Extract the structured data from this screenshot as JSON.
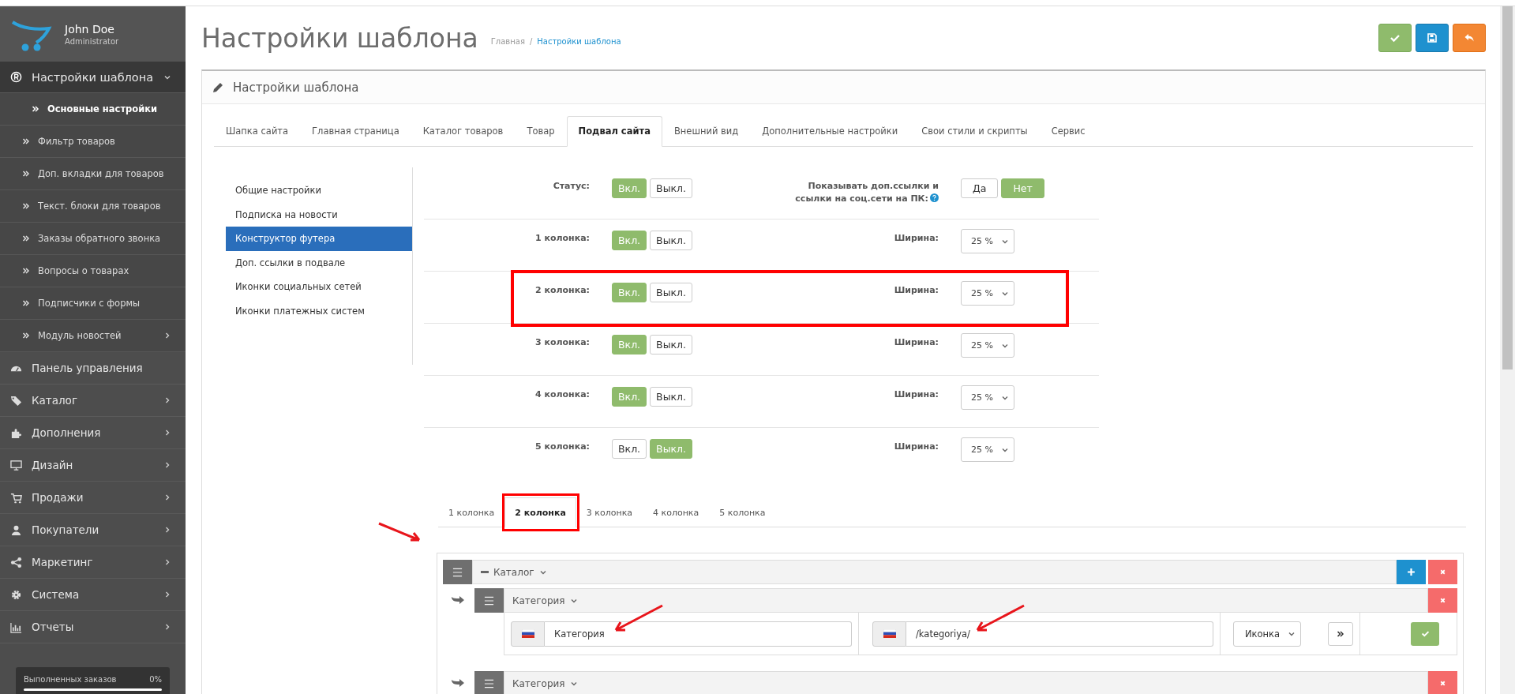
{
  "sidebar": {
    "user": {
      "name": "John Doe",
      "role": "Administrator"
    },
    "menu": [
      {
        "label": "Настройки шаблона",
        "kind": "registered",
        "expandable": true,
        "expanded": true,
        "children": [
          {
            "label": "Основные настройки",
            "selected": true,
            "expandable": false
          },
          {
            "label": "Фильтр товаров",
            "selected": false,
            "expandable": false
          },
          {
            "label": "Доп. вкладки для товаров",
            "selected": false,
            "expandable": false
          },
          {
            "label": "Текст. блоки для товаров",
            "selected": false,
            "expandable": false
          },
          {
            "label": "Заказы обратного звонка",
            "selected": false,
            "expandable": false
          },
          {
            "label": "Вопросы о товарах",
            "selected": false,
            "expandable": false
          },
          {
            "label": "Подписчики с формы",
            "selected": false,
            "expandable": false
          },
          {
            "label": "Модуль новостей",
            "selected": false,
            "expandable": true
          }
        ]
      },
      {
        "label": "Панель управления",
        "kind": "dashboard",
        "expandable": false,
        "expanded": false
      },
      {
        "label": "Каталог",
        "kind": "tag",
        "expandable": true,
        "expanded": false
      },
      {
        "label": "Дополнения",
        "kind": "puzzle",
        "expandable": true,
        "expanded": false
      },
      {
        "label": "Дизайн",
        "kind": "monitor",
        "expandable": true,
        "expanded": false
      },
      {
        "label": "Продажи",
        "kind": "cart",
        "expandable": true,
        "expanded": false
      },
      {
        "label": "Покупатели",
        "kind": "user",
        "expandable": true,
        "expanded": false
      },
      {
        "label": "Маркетинг",
        "kind": "share",
        "expandable": true,
        "expanded": false
      },
      {
        "label": "Система",
        "kind": "gear",
        "expandable": true,
        "expanded": false
      },
      {
        "label": "Отчеты",
        "kind": "chart",
        "expandable": true,
        "expanded": false
      }
    ],
    "progress": {
      "label": "Выполненных заказов",
      "value": "0%",
      "level": 0
    }
  },
  "page": {
    "title": "Настройки шаблона",
    "breadcrumb": [
      {
        "label": "Главная",
        "current": false
      },
      {
        "separator": "/",
        "label": "Настройки шаблона",
        "current": true
      }
    ],
    "actions": [
      {
        "kind": "apply"
      },
      {
        "kind": "save"
      },
      {
        "kind": "back"
      }
    ]
  },
  "panel": {
    "title": "Настройки шаблона",
    "tabs": [
      {
        "label": "Шапка сайта",
        "selected": false
      },
      {
        "label": "Главная страница",
        "selected": false
      },
      {
        "label": "Каталог товаров",
        "selected": false
      },
      {
        "label": "Товар",
        "selected": false
      },
      {
        "label": "Подвал сайта",
        "selected": true
      },
      {
        "label": "Внешний вид",
        "selected": false
      },
      {
        "label": "Дополнительные настройки",
        "selected": false
      },
      {
        "label": "Свои стили и скрипты",
        "selected": false
      },
      {
        "label": "Сервис",
        "selected": false
      }
    ],
    "nav": [
      {
        "label": "Общие настройки",
        "selected": false
      },
      {
        "label": "Подписка на новости",
        "selected": false
      },
      {
        "label": "Конструктор футера",
        "selected": true
      },
      {
        "label": "Доп. ссылки в подвале",
        "selected": false
      },
      {
        "label": "Иконки социальных сетей",
        "selected": false
      },
      {
        "label": "Иконки платежных систем",
        "selected": false
      }
    ],
    "rows": [
      {
        "label": "Статус:",
        "outlined": false,
        "options": [
          {
            "label": "Вкл.",
            "selected": true
          },
          {
            "label": "Выкл.",
            "selected": false
          }
        ],
        "side": {
          "kind": "toggle",
          "label": "Показывать доп.ссылки и ссылки на соц.сети на ПК:",
          "help": true,
          "options": [
            {
              "label": "Да",
              "selected": false
            },
            {
              "label": "Нет",
              "selected": true
            }
          ]
        }
      },
      {
        "label": "1 колонка:",
        "outlined": false,
        "options": [
          {
            "label": "Вкл.",
            "selected": true
          },
          {
            "label": "Выкл.",
            "selected": false
          }
        ],
        "side": {
          "kind": "select",
          "label": "Ширина:",
          "value": "25 %"
        }
      },
      {
        "label": "2 колонка:",
        "outlined": true,
        "options": [
          {
            "label": "Вкл.",
            "selected": true
          },
          {
            "label": "Выкл.",
            "selected": false
          }
        ],
        "side": {
          "kind": "select",
          "label": "Ширина:",
          "value": "25 %"
        }
      },
      {
        "label": "3 колонка:",
        "outlined": false,
        "options": [
          {
            "label": "Вкл.",
            "selected": true
          },
          {
            "label": "Выкл.",
            "selected": false
          }
        ],
        "side": {
          "kind": "select",
          "label": "Ширина:",
          "value": "25 %"
        }
      },
      {
        "label": "4 колонка:",
        "outlined": false,
        "options": [
          {
            "label": "Вкл.",
            "selected": true
          },
          {
            "label": "Выкл.",
            "selected": false
          }
        ],
        "side": {
          "kind": "select",
          "label": "Ширина:",
          "value": "25 %"
        }
      },
      {
        "label": "5 колонка:",
        "outlined": false,
        "options": [
          {
            "label": "Вкл.",
            "selected": false
          },
          {
            "label": "Выкл.",
            "selected": true
          }
        ],
        "side": {
          "kind": "select",
          "label": "Ширина:",
          "value": "25 %"
        }
      }
    ],
    "column_tabs": [
      {
        "label": "1 колонка",
        "selected": false,
        "outlined": false
      },
      {
        "label": "2 колонка",
        "selected": true,
        "outlined": true
      },
      {
        "label": "3 колонка",
        "selected": false,
        "outlined": false
      },
      {
        "label": "4 колонка",
        "selected": false,
        "outlined": false
      },
      {
        "label": "5 колонка",
        "selected": false,
        "outlined": false
      }
    ],
    "builder": {
      "pointed": true,
      "group": {
        "title": "Каталог",
        "items": [
          {
            "title": "Категория",
            "expanded": true,
            "name": {
              "value": "Категория",
              "pointed": true
            },
            "link": {
              "value": "/kategoriya/",
              "pointed": true
            },
            "icon_select": "Иконка"
          },
          {
            "title": "Категория",
            "expanded": false
          }
        ]
      }
    }
  }
}
